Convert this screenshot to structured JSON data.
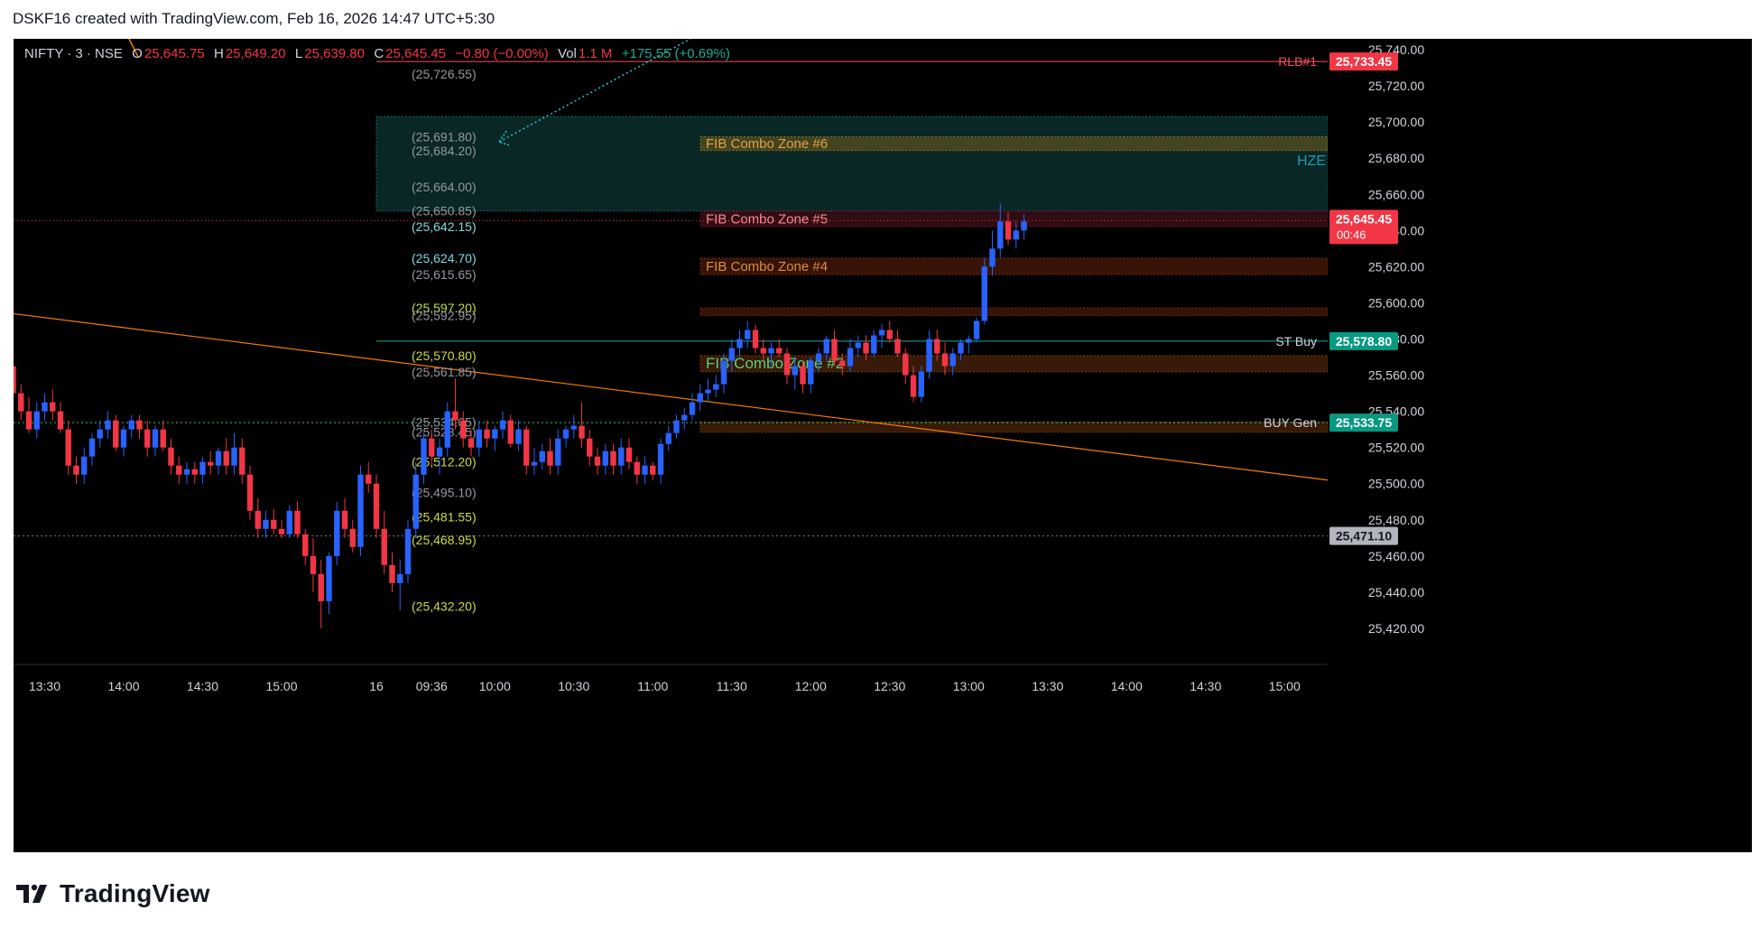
{
  "header": {
    "title": "DSKF16 created with TradingView.com, Feb 16, 2026 14:47 UTC+5:30"
  },
  "legend": {
    "symbol": "NIFTY · 3 · NSE",
    "open_key": "O",
    "open": "25,645.75",
    "high_key": "H",
    "high": "25,649.20",
    "low_key": "L",
    "low": "25,639.80",
    "close_key": "C",
    "close": "25,645.45",
    "change": "−0.80 (−0.00%)",
    "vol_key": "Vol",
    "vol": "1.1 M",
    "day_change": "+175.55 (+0.69%)"
  },
  "footer": {
    "brand": "TradingView"
  },
  "colors": {
    "up": "#2962ff",
    "down": "#f23645",
    "background": "#000000",
    "axis_text": "#d1d4dc"
  },
  "chart_data": {
    "type": "candlestick",
    "symbol": "NIFTY",
    "interval": "3",
    "exchange": "NSE",
    "ylim": [
      25410,
      25745
    ],
    "y_ticks": [
      "25,740.00",
      "25,720.00",
      "25,700.00",
      "25,680.00",
      "25,660.00",
      "25,640.00",
      "25,620.00",
      "25,600.00",
      "25,580.00",
      "25,560.00",
      "25,540.00",
      "25,520.00",
      "25,500.00",
      "25,480.00",
      "25,460.00",
      "25,440.00",
      "25,420.00"
    ],
    "y_tick_values": [
      25740,
      25720,
      25700,
      25680,
      25660,
      25640,
      25620,
      25600,
      25580,
      25560,
      25540,
      25520,
      25500,
      25480,
      25460,
      25440,
      25420
    ],
    "x_ticks": [
      {
        "label": "13:30",
        "bar": -42
      },
      {
        "label": "14:00",
        "bar": -32
      },
      {
        "label": "14:30",
        "bar": -22
      },
      {
        "label": "15:00",
        "bar": -12
      },
      {
        "label": "16",
        "bar": 0
      },
      {
        "label": "09:36",
        "bar": 7
      },
      {
        "label": "10:00",
        "bar": 15
      },
      {
        "label": "10:30",
        "bar": 25
      },
      {
        "label": "11:00",
        "bar": 35
      },
      {
        "label": "11:30",
        "bar": 45
      },
      {
        "label": "12:00",
        "bar": 55
      },
      {
        "label": "12:30",
        "bar": 65
      },
      {
        "label": "13:00",
        "bar": 75
      },
      {
        "label": "13:30",
        "bar": 85
      },
      {
        "label": "14:00",
        "bar": 95
      },
      {
        "label": "14:30",
        "bar": 105
      },
      {
        "label": "15:00",
        "bar": 115
      }
    ],
    "candles": [
      [
        25590,
        25595,
        25575,
        25580
      ],
      [
        25580,
        25588,
        25560,
        25565
      ],
      [
        25565,
        25570,
        25545,
        25550
      ],
      [
        25550,
        25555,
        25535,
        25540
      ],
      [
        25540,
        25548,
        25528,
        25530
      ],
      [
        25530,
        25545,
        25525,
        25540
      ],
      [
        25540,
        25550,
        25535,
        25545
      ],
      [
        25545,
        25552,
        25535,
        25540
      ],
      [
        25540,
        25545,
        25528,
        25530
      ],
      [
        25530,
        25535,
        25505,
        25510
      ],
      [
        25510,
        25515,
        25500,
        25505
      ],
      [
        25505,
        25520,
        25500,
        25515
      ],
      [
        25515,
        25528,
        25510,
        25525
      ],
      [
        25525,
        25535,
        25520,
        25530
      ],
      [
        25530,
        25540,
        25525,
        25535
      ],
      [
        25535,
        25538,
        25518,
        25520
      ],
      [
        25520,
        25532,
        25515,
        25530
      ],
      [
        25530,
        25538,
        25525,
        25535
      ],
      [
        25535,
        25538,
        25525,
        25530
      ],
      [
        25530,
        25535,
        25515,
        25520
      ],
      [
        25520,
        25532,
        25515,
        25530
      ],
      [
        25530,
        25535,
        25518,
        25520
      ],
      [
        25520,
        25525,
        25505,
        25510
      ],
      [
        25510,
        25515,
        25500,
        25505
      ],
      [
        25505,
        25512,
        25500,
        25508
      ],
      [
        25508,
        25512,
        25500,
        25505
      ],
      [
        25505,
        25515,
        25500,
        25512
      ],
      [
        25512,
        25518,
        25505,
        25510
      ],
      [
        25510,
        25520,
        25505,
        25518
      ],
      [
        25518,
        25525,
        25505,
        25510
      ],
      [
        25510,
        25528,
        25505,
        25520
      ],
      [
        25520,
        25525,
        25500,
        25505
      ],
      [
        25505,
        25510,
        25480,
        25485
      ],
      [
        25485,
        25492,
        25470,
        25475
      ],
      [
        25475,
        25485,
        25470,
        25480
      ],
      [
        25480,
        25486,
        25472,
        25475
      ],
      [
        25475,
        25480,
        25470,
        25472
      ],
      [
        25472,
        25488,
        25470,
        25485
      ],
      [
        25485,
        25490,
        25470,
        25472
      ],
      [
        25472,
        25475,
        25455,
        25460
      ],
      [
        25460,
        25470,
        25440,
        25450
      ],
      [
        25450,
        25458,
        25420,
        25435
      ],
      [
        25435,
        25462,
        25428,
        25460
      ],
      [
        25460,
        25490,
        25455,
        25485
      ],
      [
        25485,
        25492,
        25470,
        25475
      ],
      [
        25475,
        25480,
        25462,
        25465
      ],
      [
        25465,
        25510,
        25460,
        25505
      ],
      [
        25505,
        25512,
        25495,
        25500
      ],
      [
        25500,
        25505,
        25470,
        25475
      ],
      [
        25475,
        25485,
        25450,
        25455
      ],
      [
        25455,
        25462,
        25440,
        25445
      ],
      [
        25445,
        25458,
        25430,
        25450
      ],
      [
        25450,
        25480,
        25445,
        25475
      ],
      [
        25475,
        25512,
        25470,
        25505
      ],
      [
        25505,
        25528,
        25500,
        25525
      ],
      [
        25525,
        25530,
        25510,
        25515
      ],
      [
        25515,
        25525,
        25505,
        25520
      ],
      [
        25520,
        25545,
        25515,
        25540
      ],
      [
        25540,
        25558,
        25530,
        25535
      ],
      [
        25535,
        25540,
        25520,
        25525
      ],
      [
        25525,
        25530,
        25515,
        25520
      ],
      [
        25520,
        25535,
        25515,
        25530
      ],
      [
        25530,
        25535,
        25520,
        25525
      ],
      [
        25525,
        25532,
        25518,
        25530
      ],
      [
        25530,
        25540,
        25525,
        25535
      ],
      [
        25535,
        25538,
        25520,
        25522
      ],
      [
        25522,
        25535,
        25518,
        25530
      ],
      [
        25530,
        25532,
        25505,
        25510
      ],
      [
        25510,
        25520,
        25505,
        25512
      ],
      [
        25512,
        25522,
        25508,
        25518
      ],
      [
        25518,
        25525,
        25505,
        25510
      ],
      [
        25510,
        25530,
        25505,
        25525
      ],
      [
        25525,
        25532,
        25520,
        25530
      ],
      [
        25530,
        25538,
        25525,
        25532
      ],
      [
        25532,
        25545,
        25520,
        25525
      ],
      [
        25525,
        25530,
        25510,
        25515
      ],
      [
        25515,
        25520,
        25505,
        25510
      ],
      [
        25510,
        25522,
        25505,
        25518
      ],
      [
        25518,
        25522,
        25505,
        25510
      ],
      [
        25510,
        25525,
        25505,
        25520
      ],
      [
        25520,
        25525,
        25508,
        25512
      ],
      [
        25512,
        25515,
        25500,
        25505
      ],
      [
        25505,
        25515,
        25500,
        25510
      ],
      [
        25510,
        25512,
        25502,
        25505
      ],
      [
        25505,
        25525,
        25500,
        25522
      ],
      [
        25522,
        25532,
        25518,
        25528
      ],
      [
        25528,
        25538,
        25525,
        25535
      ],
      [
        25535,
        25542,
        25530,
        25538
      ],
      [
        25538,
        25550,
        25535,
        25545
      ],
      [
        25545,
        25555,
        25540,
        25550
      ],
      [
        25550,
        25558,
        25545,
        25552
      ],
      [
        25552,
        25560,
        25548,
        25555
      ],
      [
        25555,
        25572,
        25550,
        25568
      ],
      [
        25568,
        25580,
        25562,
        25575
      ],
      [
        25575,
        25585,
        25570,
        25580
      ],
      [
        25580,
        25590,
        25575,
        25585
      ],
      [
        25585,
        25588,
        25572,
        25575
      ],
      [
        25575,
        25580,
        25568,
        25572
      ],
      [
        25572,
        25578,
        25565,
        25575
      ],
      [
        25575,
        25580,
        25570,
        25572
      ],
      [
        25572,
        25575,
        25555,
        25560
      ],
      [
        25560,
        25570,
        25552,
        25565
      ],
      [
        25565,
        25568,
        25550,
        25555
      ],
      [
        25555,
        25570,
        25550,
        25568
      ],
      [
        25568,
        25575,
        25562,
        25572
      ],
      [
        25572,
        25582,
        25568,
        25580
      ],
      [
        25580,
        25585,
        25565,
        25568
      ],
      [
        25568,
        25572,
        25560,
        25565
      ],
      [
        25565,
        25580,
        25562,
        25575
      ],
      [
        25575,
        25582,
        25570,
        25578
      ],
      [
        25578,
        25582,
        25568,
        25572
      ],
      [
        25572,
        25585,
        25570,
        25582
      ],
      [
        25582,
        25588,
        25575,
        25585
      ],
      [
        25585,
        25590,
        25578,
        25580
      ],
      [
        25580,
        25585,
        25570,
        25572
      ],
      [
        25572,
        25575,
        25555,
        25560
      ],
      [
        25560,
        25565,
        25545,
        25548
      ],
      [
        25548,
        25565,
        25545,
        25562
      ],
      [
        25562,
        25585,
        25558,
        25580
      ],
      [
        25580,
        25585,
        25568,
        25572
      ],
      [
        25572,
        25578,
        25560,
        25565
      ],
      [
        25565,
        25575,
        25560,
        25572
      ],
      [
        25572,
        25580,
        25568,
        25578
      ],
      [
        25578,
        25582,
        25572,
        25580
      ],
      [
        25580,
        25592,
        25578,
        25590
      ],
      [
        25590,
        25625,
        25588,
        25620
      ],
      [
        25620,
        25640,
        25615,
        25630
      ],
      [
        25630,
        25655,
        25625,
        25645
      ],
      [
        25645,
        25650,
        25632,
        25635
      ],
      [
        25635,
        25645,
        25630,
        25640
      ],
      [
        25640,
        25649,
        25635,
        25645
      ]
    ],
    "horizontal_levels": [
      {
        "name": "RLB#1",
        "value": 25733.45,
        "label": "25,733.45",
        "color": "#f7525f"
      },
      {
        "name": "ST Buy",
        "value": 25578.8,
        "label": "25,578.80",
        "color": "#26a69a"
      },
      {
        "name": "BUY Gen",
        "value": 25533.75,
        "label": "25,533.75",
        "color": "#2ecc71"
      },
      {
        "name": "",
        "value": 25471.1,
        "label": "25,471.10",
        "color": "#787b86"
      }
    ],
    "current_price": {
      "value": 25645.45,
      "label": "25,645.45",
      "countdown": "00:46"
    },
    "zones": [
      {
        "name": "FIB Combo Zone #6",
        "low": 25684.2,
        "high": 25691.8
      },
      {
        "name": "FIB Combo Zone #5",
        "low": 25642.15,
        "high": 25650.85
      },
      {
        "name": "FIB Combo Zone #4",
        "low": 25615.65,
        "high": 25624.7
      },
      {
        "name": "",
        "low": 25592.95,
        "high": 25597.2
      },
      {
        "name": "FIB Combo Zone #2",
        "low": 25561.85,
        "high": 25570.8
      },
      {
        "name": "",
        "low": 25528.45,
        "high": 25534.05
      }
    ],
    "hze_zone": {
      "name": "HZE",
      "low": 25650.85,
      "high": 25703
    }
  },
  "level_labels": [
    {
      "text": "(25,726.55)",
      "value": 25726.5,
      "color": "#9598a1"
    },
    {
      "text": "(25,691.80)",
      "value": 25691.8,
      "color": "#9598a1"
    },
    {
      "text": "(25,684.20)",
      "value": 25684.2,
      "color": "#9598a1"
    },
    {
      "text": "(25,664.00)",
      "value": 25664.0,
      "color": "#9598a1"
    },
    {
      "text": "(25,650.85)",
      "value": 25650.85,
      "color": "#9598a1"
    },
    {
      "text": "(25,642.15)",
      "value": 25642.15,
      "color": "#7fdbe6"
    },
    {
      "text": "(25,624.70)",
      "value": 25624.7,
      "color": "#7fdbe6"
    },
    {
      "text": "(25,615.65)",
      "value": 25615.65,
      "color": "#9598a1"
    },
    {
      "text": "(25,597.20)",
      "value": 25597.2,
      "color": "#cddc39"
    },
    {
      "text": "(25,592.95)",
      "value": 25592.95,
      "color": "#9598a1"
    },
    {
      "text": "(25,570.80)",
      "value": 25570.8,
      "color": "#cddc39"
    },
    {
      "text": "(25,561.85)",
      "value": 25561.85,
      "color": "#9598a1"
    },
    {
      "text": "(25,534.05)",
      "value": 25534.05,
      "color": "#9598a1"
    },
    {
      "text": "(25,528.45)",
      "value": 25528.45,
      "color": "#9598a1"
    },
    {
      "text": "(25,512.20)",
      "value": 25512.2,
      "color": "#cddc39"
    },
    {
      "text": "(25,495.10)",
      "value": 25495.1,
      "color": "#9598a1"
    },
    {
      "text": "(25,481.55)",
      "value": 25481.55,
      "color": "#cddc39"
    },
    {
      "text": "(25,468.95)",
      "value": 25468.95,
      "color": "#cddc39"
    },
    {
      "text": "(25,432.20)",
      "value": 25432.2,
      "color": "#cddc39"
    }
  ]
}
